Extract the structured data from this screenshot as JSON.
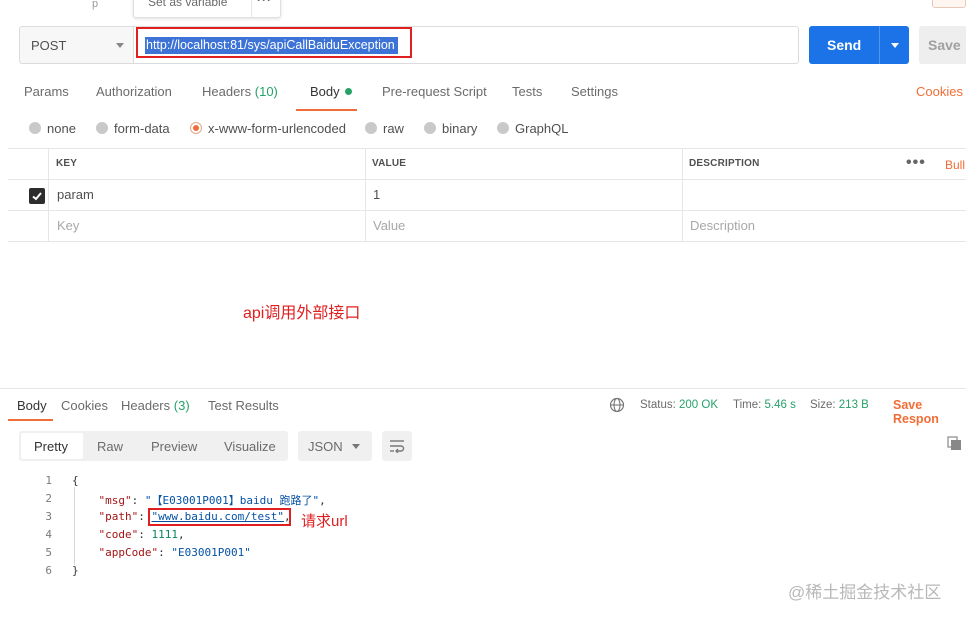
{
  "tooltip": {
    "label": "Set as variable",
    "more": "···"
  },
  "request": {
    "method": "POST",
    "url": "http://localhost:81/sys/apiCallBaiduException",
    "send_label": "Send",
    "save_label": "Save"
  },
  "req_tabs": {
    "params": "Params",
    "authorization": "Authorization",
    "headers": "Headers",
    "headers_count": "(10)",
    "body": "Body",
    "prerequest": "Pre-request Script",
    "tests": "Tests",
    "settings": "Settings",
    "cookies": "Cookies"
  },
  "body_types": {
    "none": "none",
    "form_data": "form-data",
    "urlencoded": "x-www-form-urlencoded",
    "raw": "raw",
    "binary": "binary",
    "graphql": "GraphQL"
  },
  "param_table": {
    "headers": {
      "key": "KEY",
      "value": "VALUE",
      "description": "DESCRIPTION"
    },
    "bulk_edit": "Bull",
    "rows": [
      {
        "key": "param",
        "value": "1",
        "description": ""
      }
    ],
    "placeholders": {
      "key": "Key",
      "value": "Value",
      "description": "Description"
    }
  },
  "annotations": {
    "api_note": "api调用外部接口",
    "url_note": "请求url"
  },
  "response": {
    "tabs": {
      "body": "Body",
      "cookies": "Cookies",
      "headers": "Headers",
      "headers_count": "(3)",
      "test_results": "Test Results"
    },
    "status_label": "Status:",
    "status_value": "200 OK",
    "time_label": "Time:",
    "time_value": "5.46 s",
    "size_label": "Size:",
    "size_value": "213 B",
    "save_response": "Save Respon",
    "formats": {
      "pretty": "Pretty",
      "raw": "Raw",
      "preview": "Preview",
      "visualize": "Visualize"
    },
    "language": "JSON",
    "lines": [
      "1",
      "2",
      "3",
      "4",
      "5",
      "6"
    ],
    "json": {
      "open": "{",
      "msg_key": "\"msg\"",
      "msg_val": "\"【E03001P001】baidu 跑路了\"",
      "path_key": "\"path\"",
      "path_val": "\"www.baidu.com/test\"",
      "code_key": "\"code\"",
      "code_val": "1111",
      "appcode_key": "\"appCode\"",
      "appcode_val": "\"E03001P001\"",
      "close": "}"
    }
  },
  "watermark": "@稀土掘金技术社区",
  "colors": {
    "accent": "#f06d37",
    "send": "#1c73e8",
    "success": "#26a269",
    "annotation": "#e02020"
  }
}
